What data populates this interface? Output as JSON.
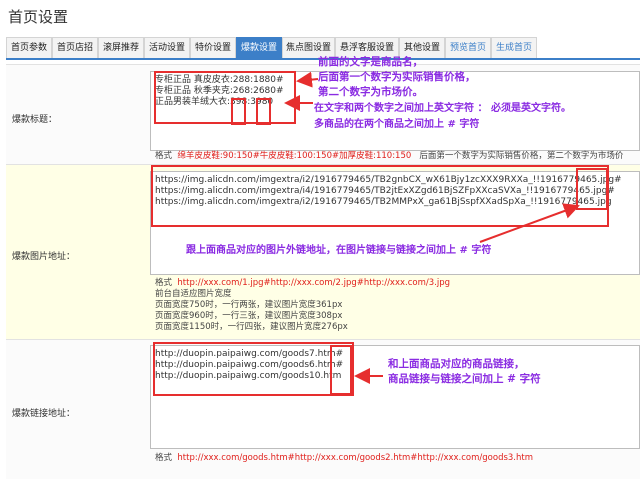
{
  "title": "首页设置",
  "tabs": [
    {
      "label": "首页参数"
    },
    {
      "label": "首页店招"
    },
    {
      "label": "滚屏推荐"
    },
    {
      "label": "活动设置"
    },
    {
      "label": "特价设置"
    },
    {
      "label": "爆款设置"
    },
    {
      "label": "焦点图设置"
    },
    {
      "label": "悬浮客服设置"
    },
    {
      "label": "其他设置"
    },
    {
      "label": "预览首页"
    },
    {
      "label": "生成首页"
    }
  ],
  "active_tab": "爆款设置",
  "fields": {
    "title": {
      "label": "爆款标题：",
      "lines": [
        "专柜正品 真皮皮衣:288:1880#",
        "专柜正品 秋季夹克:268:2680#",
        "正品男装羊绒大衣:398:3980"
      ],
      "format_prefix": "格式",
      "format_example": "绵羊皮皮鞋:90:150#牛皮皮鞋:100:150#加厚皮鞋:110:150",
      "format_note": "后面第一个数字为实际销售价格，第二个数字为市场价"
    },
    "image": {
      "label": "爆款图片地址：",
      "lines": [
        "https://img.alicdn.com/imgextra/i2/1916779465/TB2gnbCX_wX61Bjy1zcXXX9RXXa_!!1916779465.jpg#",
        "https://img.alicdn.com/imgextra/i4/1916779465/TB2jtExXZgd61BjSZFpXXcaSVXa_!!1916779465.jpg#",
        "https://img.alicdn.com/imgextra/i2/1916779465/TB2MMPxX_ga61BjSspfXXadSpXa_!!1916779465.jpg"
      ],
      "format_prefix": "格式",
      "format_example": "http://xxx.com/1.jpg#http://xxx.com/2.jpg#http://xxx.com/3.jpg",
      "notes": [
        "前台自适应图片宽度",
        "页面宽度750时，一行两张，建议图片宽度361px",
        "页面宽度960时，一行三张，建议图片宽度308px",
        "页面宽度1150时，一行四张，建议图片宽度276px"
      ]
    },
    "link": {
      "label": "爆款链接地址：",
      "lines": [
        "http://duopin.paipaiwg.com/goods7.htm#",
        "http://duopin.paipaiwg.com/goods6.htm#",
        "http://duopin.paipaiwg.com/goods10.htm"
      ],
      "format_prefix": "格式",
      "format_example": "http://xxx.com/goods.htm#http://xxx.com/goods2.htm#http://xxx.com/goods3.htm"
    }
  },
  "annotations": {
    "a1": [
      "前面的文字是商品名，",
      "后面第一个数字为实际销售价格，",
      "第二个数字为市场价。"
    ],
    "a2": [
      "在文字和两个数字之间加上英文字符 ：  必须是英文字符。",
      "多商品的在两个商品之间加上 # 字符"
    ],
    "a3": "跟上面商品对应的图片外链地址，在图片链接与链接之间加上 # 字符",
    "a4": [
      "和上面商品对应的商品链接，",
      "商品链接与链接之间加上 # 字符"
    ]
  },
  "colors": {
    "accent": "#3c7fc8",
    "annotation": "#8a2be2",
    "highlight": "#e62e2e",
    "format_red": "#e0201c"
  }
}
